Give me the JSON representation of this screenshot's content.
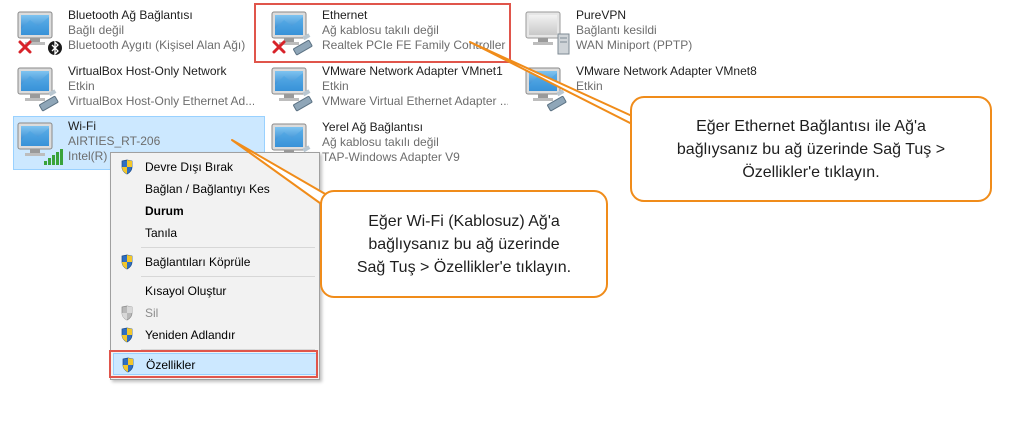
{
  "adapters": [
    {
      "name": "Bluetooth Ağ Bağlantısı",
      "status": "Bağlı değil",
      "device": "Bluetooth Aygıtı (Kişisel Alan Ağı)"
    },
    {
      "name": "Ethernet",
      "status": "Ağ kablosu takılı değil",
      "device": "Realtek PCIe FE Family Controller"
    },
    {
      "name": "PureVPN",
      "status": "Bağlantı kesildi",
      "device": "WAN Miniport (PPTP)"
    },
    {
      "name": "VirtualBox Host-Only Network",
      "status": "Etkin",
      "device": "VirtualBox Host-Only Ethernet Ad..."
    },
    {
      "name": "VMware Network Adapter VMnet1",
      "status": "Etkin",
      "device": "VMware Virtual Ethernet Adapter ..."
    },
    {
      "name": "VMware Network Adapter VMnet8",
      "status": "Etkin",
      "device": ""
    },
    {
      "name": "Wi-Fi",
      "status": "AIRTIES_RT-206",
      "device": "Intel(R)"
    },
    {
      "name": "Yerel Ağ Bağlantısı",
      "status": "Ağ kablosu takılı değil",
      "device": "TAP-Windows Adapter V9"
    }
  ],
  "context_menu": {
    "items": [
      {
        "label": "Devre Dışı Bırak",
        "shield": true
      },
      {
        "label": "Bağlan / Bağlantıyı Kes",
        "shield": false
      },
      {
        "label": "Durum",
        "shield": false
      },
      {
        "label": "Tanıla",
        "shield": false
      },
      {
        "label": "Bağlantıları Köprüle",
        "shield": true
      },
      {
        "label": "Kısayol Oluştur",
        "shield": false
      },
      {
        "label": "Sil",
        "shield": true
      },
      {
        "label": "Yeniden Adlandır",
        "shield": true
      },
      {
        "label": "Özellikler",
        "shield": true
      }
    ]
  },
  "callouts": {
    "ethernet": [
      "Eğer Ethernet Bağlantısı ile Ağ'a",
      "bağlıysanız bu ağ üzerinde Sağ Tuş >",
      "Özellikler'e tıklayın."
    ],
    "wifi": [
      "Eğer Wi-Fi (Kablosuz) Ağ'a",
      "bağlıysanız bu ağ üzerinde",
      "Sağ Tuş > Özellikler'e tıklayın."
    ]
  },
  "colors": {
    "accent": "#f08c1a",
    "highlight_box": "#e0554b",
    "selection": "#cce8ff"
  },
  "icons": [
    "network-monitor-icon",
    "cable-plug-icon",
    "red-x-icon",
    "bluetooth-icon",
    "wifi-bars-icon",
    "uac-shield-icon",
    "vpn-server-icon"
  ]
}
